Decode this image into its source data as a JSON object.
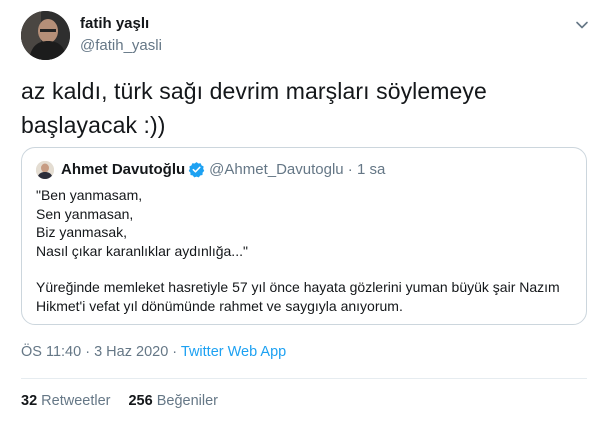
{
  "author": {
    "name": "fatih yaşlı",
    "handle": "@fatih_yasli"
  },
  "tweet_text": "az kaldı, türk sağı devrim marşları söylemeye başlayacak :))",
  "quoted": {
    "name": "Ahmet Davutoğlu",
    "handle": "@Ahmet_Davutoglu",
    "separator": " · ",
    "time": "1 sa",
    "lines": [
      "\"Ben yanmasam,",
      "Sen yanmasan,",
      "Biz yanmasak,",
      "Nasıl çıkar karanlıklar aydınlığa...\""
    ],
    "paragraph": "Yüreğinde memleket hasretiyle 57 yıl önce hayata gözlerini yuman büyük şair Nazım Hikmet'i vefat yıl dönümünde rahmet ve saygıyla anıyorum."
  },
  "meta": {
    "time": "ÖS 11:40",
    "sep1": " · ",
    "date": "3 Haz 2020",
    "sep2": " · ",
    "source": "Twitter Web App"
  },
  "stats": {
    "retweets_count": "32",
    "retweets_label": "Retweetler",
    "likes_count": "256",
    "likes_label": "Beğeniler"
  },
  "colors": {
    "accent": "#1da1f2",
    "secondary_text": "#657786",
    "border": "#ccd6dd"
  },
  "icons": {
    "caret": "chevron-down-icon",
    "verified": "verified-badge-icon"
  }
}
